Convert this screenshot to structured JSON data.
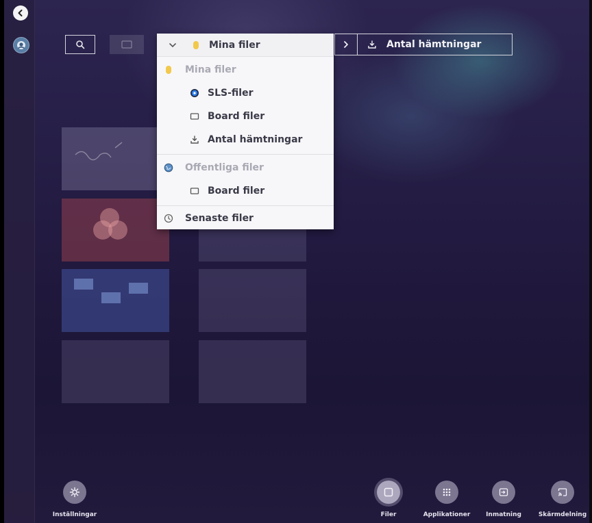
{
  "sidebar": {
    "back_icon": "chevron-left-icon",
    "avatar_icon": "avatar-icon"
  },
  "toolbar": {
    "search_icon": "search-icon",
    "view_icon": "folder-view-icon"
  },
  "path_bar": {
    "chevron_icon": "chevron-right-icon",
    "current_icon": "download-icon",
    "current_label": "Antal hämtningar"
  },
  "dropdown": {
    "header": {
      "label": "Mina filer",
      "icon": "folder-yellow-icon",
      "expand_icon": "chevron-down-icon"
    },
    "sections": [
      {
        "title": "Mina filer",
        "icon": "folder-yellow-icon",
        "items": [
          {
            "label": "SLS-filer",
            "icon": "sls-disc-icon"
          },
          {
            "label": "Board filer",
            "icon": "board-icon"
          },
          {
            "label": "Antal hämtningar",
            "icon": "download-icon"
          }
        ]
      },
      {
        "title": "Offentliga filer",
        "icon": "globe-icon",
        "items": [
          {
            "label": "Board filer",
            "icon": "board-icon"
          }
        ]
      }
    ],
    "recent": {
      "label": "Senaste filer",
      "icon": "clock-icon"
    }
  },
  "dock": {
    "settings_label": "Inställningar",
    "files_label": "Filer",
    "apps_label": "Applikationer",
    "input_label": "Inmatning",
    "screenshare_label": "Skärmdelning"
  },
  "colors": {
    "background": "#221a40",
    "dropdown_bg": "#f7f7f9",
    "muted_text": "#a9a9b4",
    "folder_yellow": "#f2c94c",
    "sls_blue": "#2f80ed"
  }
}
